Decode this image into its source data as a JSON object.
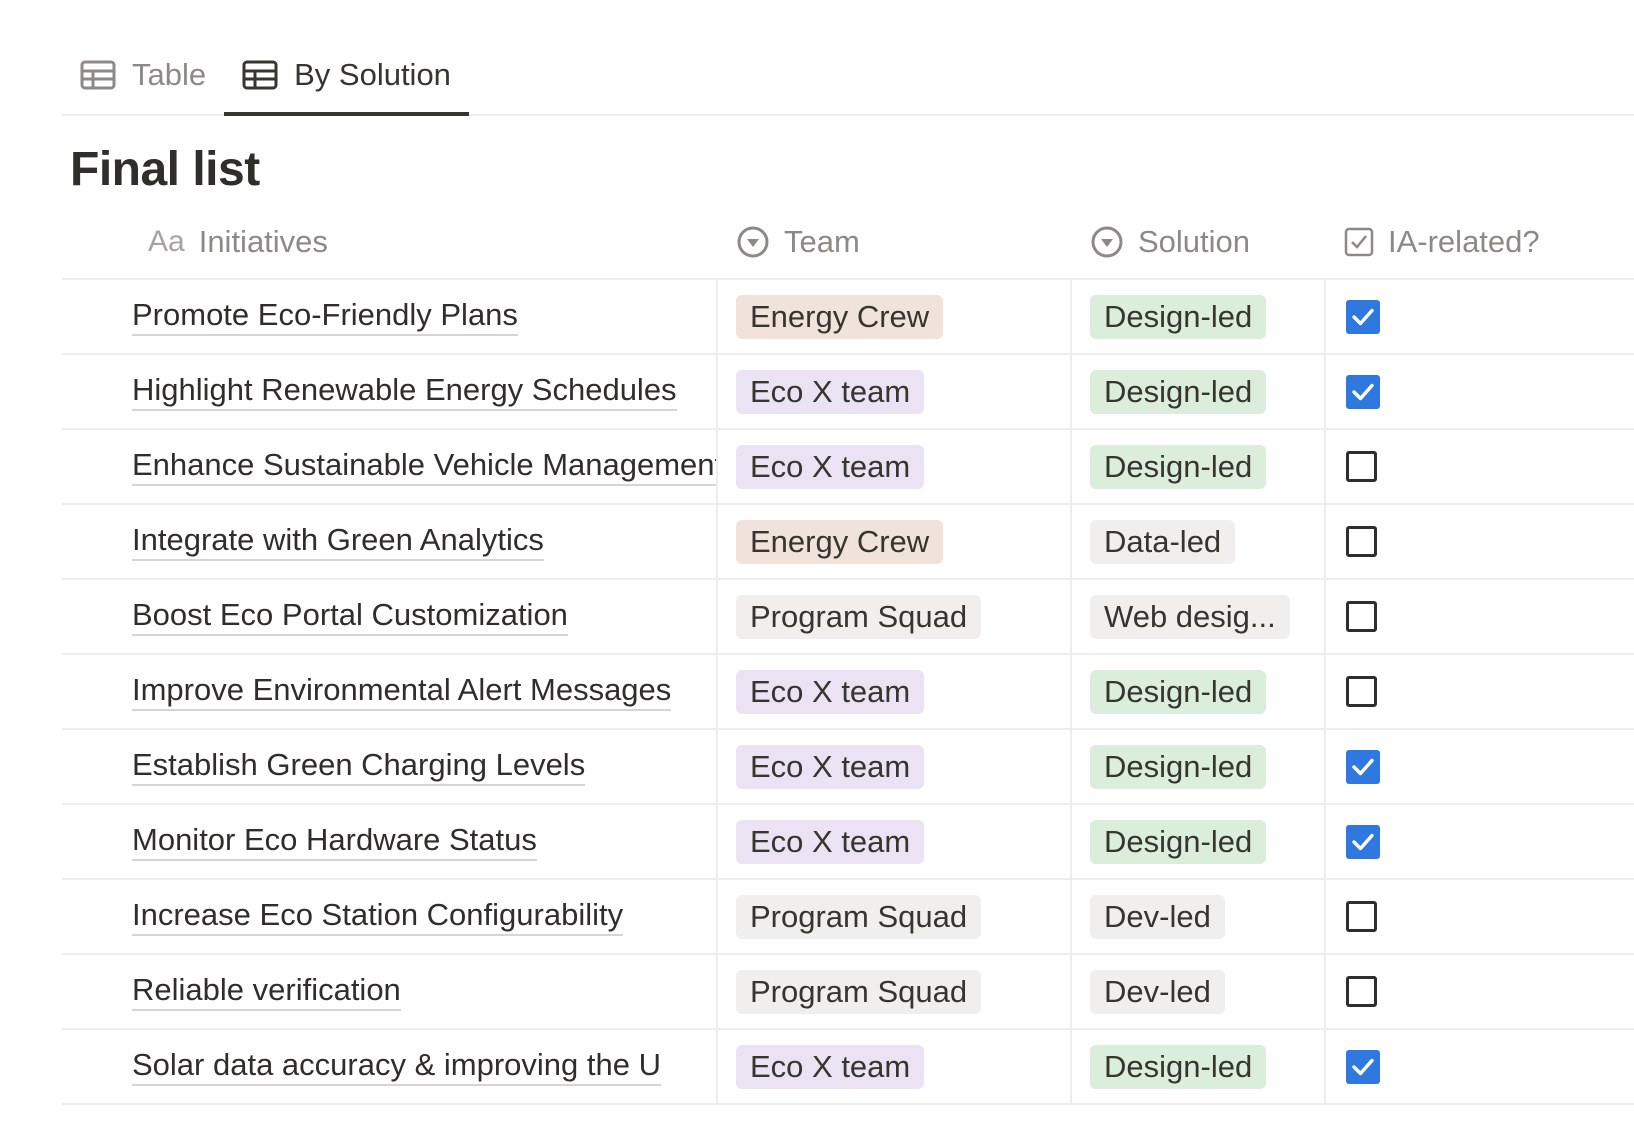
{
  "tabs": [
    {
      "label": "Table",
      "active": false
    },
    {
      "label": "By Solution",
      "active": true
    }
  ],
  "title": "Final list",
  "columns": {
    "initiatives": {
      "prefix": "Aa",
      "label": "Initiatives"
    },
    "team": {
      "label": "Team"
    },
    "solution": {
      "label": "Solution"
    },
    "ia": {
      "label": "IA-related?"
    }
  },
  "colors": {
    "Energy Crew": "#f0e3dc",
    "Eco X team": "#ebe2f3",
    "Program Squad": "#f0efed",
    "Design-led": "#dbeddb",
    "Data-led": "#f0efed",
    "Web desig...": "#f0efed",
    "Dev-led": "#f0efed",
    "checked": "#2f78df"
  },
  "rows": [
    {
      "initiative": "Promote Eco-Friendly Plans",
      "team": "Energy Crew",
      "solution": "Design-led",
      "ia": true
    },
    {
      "initiative": "Highlight Renewable Energy Schedules",
      "team": "Eco X team",
      "solution": "Design-led",
      "ia": true
    },
    {
      "initiative": "Enhance Sustainable Vehicle Management",
      "team": "Eco X team",
      "solution": "Design-led",
      "ia": false
    },
    {
      "initiative": "Integrate with Green Analytics",
      "team": "Energy Crew",
      "solution": "Data-led",
      "ia": false
    },
    {
      "initiative": "Boost Eco Portal Customization",
      "team": "Program Squad",
      "solution": "Web desig...",
      "ia": false
    },
    {
      "initiative": "Improve Environmental Alert Messages",
      "team": "Eco X team",
      "solution": "Design-led",
      "ia": false
    },
    {
      "initiative": "Establish Green Charging Levels",
      "team": "Eco X team",
      "solution": "Design-led",
      "ia": true
    },
    {
      "initiative": "Monitor Eco Hardware Status",
      "team": "Eco X team",
      "solution": "Design-led",
      "ia": true
    },
    {
      "initiative": "Increase Eco Station Configurability",
      "team": "Program Squad",
      "solution": "Dev-led",
      "ia": false
    },
    {
      "initiative": "Reliable verification",
      "team": "Program Squad",
      "solution": "Dev-led",
      "ia": false
    },
    {
      "initiative": "Solar data accuracy & improving the U",
      "team": "Eco X team",
      "solution": "Design-led",
      "ia": true
    }
  ]
}
